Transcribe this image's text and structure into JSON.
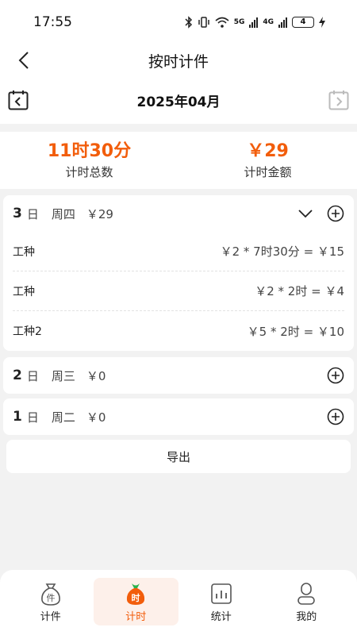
{
  "status_bar": {
    "time": "17:55",
    "network_5g": "5G",
    "network_4g": "4G",
    "battery": "4"
  },
  "header": {
    "title": "按时计件"
  },
  "month": {
    "label": "2025年04月"
  },
  "summary": {
    "total_time": "11时30分",
    "total_time_label": "计时总数",
    "total_amount": "￥29",
    "total_amount_label": "计时金额"
  },
  "days": [
    {
      "day": "3",
      "ri": "日",
      "weekday": "周四",
      "total": "￥29",
      "expanded": true,
      "entries": [
        {
          "name": "工种",
          "formula": "￥2 * 7时30分 =  ￥15"
        },
        {
          "name": "工种",
          "formula": "￥2 * 2时 =  ￥4"
        },
        {
          "name": "工种2",
          "formula": "￥5 * 2时 =  ￥10"
        }
      ]
    },
    {
      "day": "2",
      "ri": "日",
      "weekday": "周三",
      "total": "￥0"
    },
    {
      "day": "1",
      "ri": "日",
      "weekday": "周二",
      "total": "￥0"
    }
  ],
  "export_label": "导出",
  "tabs": [
    {
      "label": "计件",
      "icon": "piecework-bag-icon",
      "active": false
    },
    {
      "label": "计时",
      "icon": "timer-bag-icon",
      "active": true
    },
    {
      "label": "统计",
      "icon": "statistics-chart-icon",
      "active": false
    },
    {
      "label": "我的",
      "icon": "profile-person-icon",
      "active": false
    }
  ],
  "colors": {
    "accent": "#f25d0b",
    "active_tab_bg": "#fdf0ea",
    "background": "#f2f2f2"
  }
}
